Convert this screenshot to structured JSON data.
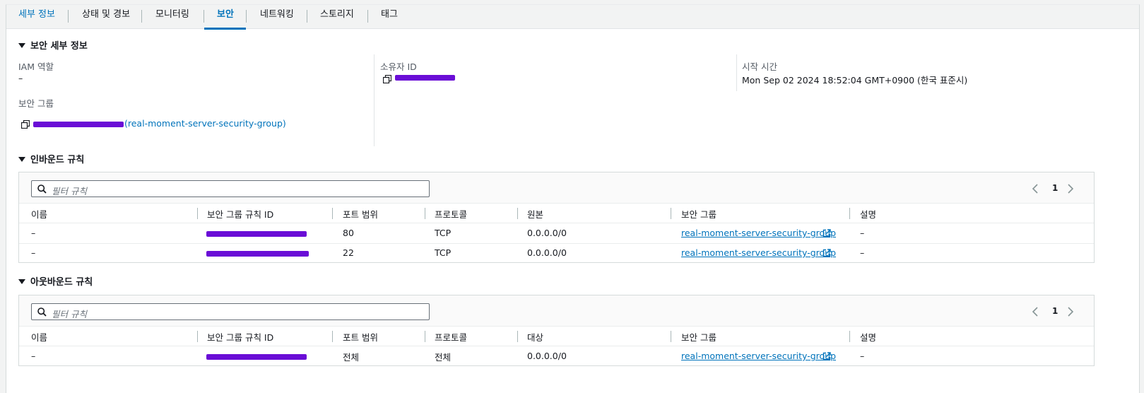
{
  "tabs": [
    {
      "label": "세부 정보"
    },
    {
      "label": "상태 및 경보"
    },
    {
      "label": "모니터링"
    },
    {
      "label": "보안"
    },
    {
      "label": "네트워킹"
    },
    {
      "label": "스토리지"
    },
    {
      "label": "태그"
    }
  ],
  "active_tab": "보안",
  "security_details": {
    "header": "보안 세부 정보",
    "iam_role_label": "IAM 역할",
    "iam_role_value": "–",
    "security_group_label": "보안 그룹",
    "security_group_link_suffix": "(real-moment-server-security-group)",
    "owner_id_label": "소유자 ID",
    "launch_time_label": "시작 시간",
    "launch_time_value": "Mon Sep 02 2024 18:52:04 GMT+0900 (한국 표준시)"
  },
  "inbound": {
    "header": "인바운드 규칙",
    "search_placeholder": "필터 규칙",
    "page": "1",
    "columns": [
      "이름",
      "보안 그룹 규칙 ID",
      "포트 범위",
      "프로토콜",
      "원본",
      "보안 그룹",
      "설명"
    ],
    "rows": [
      {
        "name": "–",
        "port": "80",
        "protocol": "TCP",
        "source": "0.0.0.0/0",
        "sg": "real-moment-server-security-group",
        "desc": "–"
      },
      {
        "name": "–",
        "port": "22",
        "protocol": "TCP",
        "source": "0.0.0.0/0",
        "sg": "real-moment-server-security-group",
        "desc": "–"
      }
    ]
  },
  "outbound": {
    "header": "아웃바운드 규칙",
    "search_placeholder": "필터 규칙",
    "page": "1",
    "columns": [
      "이름",
      "보안 그룹 규칙 ID",
      "포트 범위",
      "프로토콜",
      "대상",
      "보안 그룹",
      "설명"
    ],
    "rows": [
      {
        "name": "–",
        "port": "전체",
        "protocol": "전체",
        "dest": "0.0.0.0/0",
        "sg": "real-moment-server-security-group",
        "desc": "–"
      }
    ]
  },
  "colors": {
    "accent": "#0073bb",
    "redaction": "#6a0dd6"
  }
}
